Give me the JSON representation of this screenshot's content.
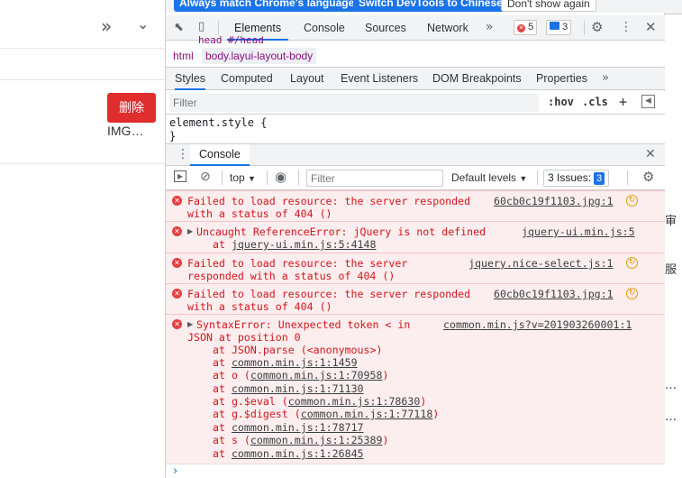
{
  "page": {
    "more_glyph": "»",
    "chevron_glyph": "⌄",
    "delete_label": "删除",
    "image_label": "IMG…"
  },
  "strip": {
    "char1": "审",
    "char2": "服",
    "dots1": "…",
    "dots2": "…"
  },
  "banner": {
    "always_match": "Always match Chrome's language",
    "switch": "Switch DevTools to Chinese",
    "dont_show": "Don't show again"
  },
  "tabbar": {
    "tabs": [
      "Elements",
      "Console",
      "Sources",
      "Network"
    ],
    "more": "»",
    "errors_count": "5",
    "messages_count": "3"
  },
  "breadcrumbs": {
    "partial": "head  #/head",
    "items": [
      "html",
      "body.layui-layout-body"
    ]
  },
  "styles": {
    "subtabs": [
      "Styles",
      "Computed",
      "Layout",
      "Event Listeners",
      "DOM Breakpoints",
      "Properties"
    ],
    "more": "»",
    "filter_placeholder": "Filter",
    "hov": ":hov",
    "cls": ".cls",
    "add": "+",
    "rule_line1": "element.style {",
    "rule_line2": "}"
  },
  "drawer": {
    "tab": "Console"
  },
  "console_toolbar": {
    "context": "top",
    "filter_placeholder": "Filter",
    "levels": "Default levels",
    "issues_label": "3 Issues:",
    "issues_count": "3"
  },
  "messages": [
    {
      "line1": "Failed to load resource: the server responded",
      "line2": "with a status of 404 ()",
      "source": "60cb0c19f1103.jpg:1"
    },
    {
      "line1": "Uncaught ReferenceError: jQuery is not defined",
      "line2_prefix": "at ",
      "line2_link": "jquery-ui.min.js:5:4148",
      "source": "jquery-ui.min.js:5"
    },
    {
      "line1": "Failed to load resource: the server",
      "line2": "responded with a status of 404 ()",
      "source": "jquery.nice-select.js:1"
    },
    {
      "line1": "Failed to load resource: the server responded",
      "line2": "with a status of 404 ()",
      "source": "60cb0c19f1103.jpg:1"
    },
    {
      "line1": "SyntaxError: Unexpected token < in",
      "line2": "JSON at position 0",
      "source": "common.min.js?v=201903260001:1",
      "stack": [
        {
          "prefix": "at JSON.parse (<anonymous>)",
          "link": "",
          "suffix": ""
        },
        {
          "prefix": "at ",
          "link": "common.min.js:1:1459",
          "suffix": ""
        },
        {
          "prefix": "at o (",
          "link": "common.min.js:1:70958",
          "suffix": ")"
        },
        {
          "prefix": "at ",
          "link": "common.min.js:1:71130",
          "suffix": ""
        },
        {
          "prefix": "at g.$eval (",
          "link": "common.min.js:1:78630",
          "suffix": ")"
        },
        {
          "prefix": "at g.$digest (",
          "link": "common.min.js:1:77118",
          "suffix": ")"
        },
        {
          "prefix": "at ",
          "link": "common.min.js:1:78717",
          "suffix": ""
        },
        {
          "prefix": "at s (",
          "link": "common.min.js:1:25389",
          "suffix": ")"
        },
        {
          "prefix": "at ",
          "link": "common.min.js:1:26845",
          "suffix": ""
        }
      ]
    }
  ],
  "prompt": {
    "glyph": "›"
  }
}
